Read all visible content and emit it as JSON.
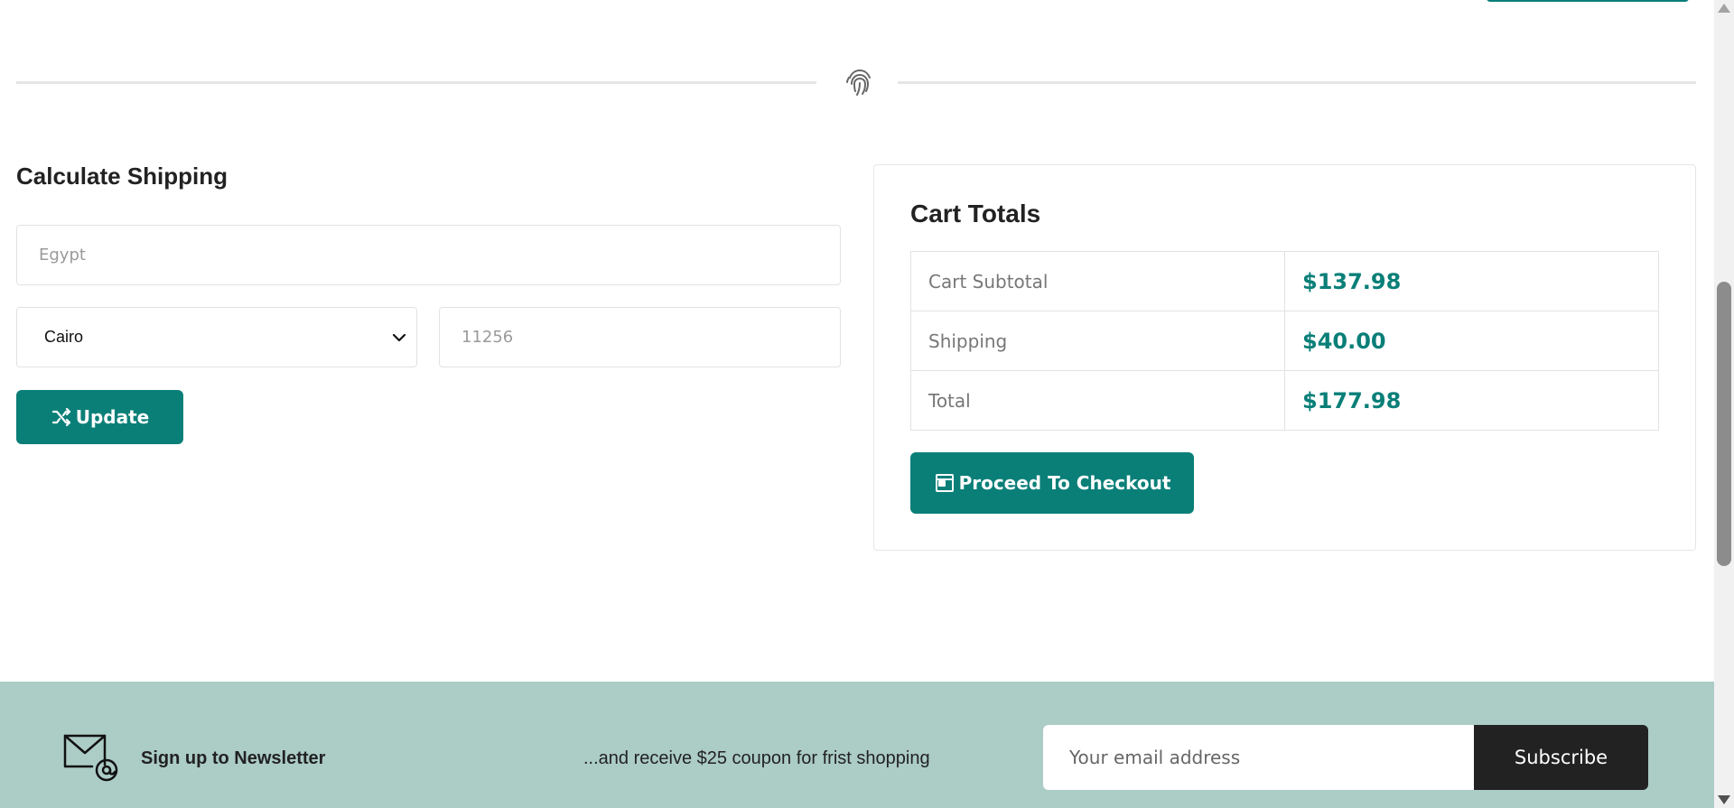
{
  "shipping": {
    "title": "Calculate Shipping",
    "country_placeholder": "Egypt",
    "city_value": "Cairo",
    "zip_placeholder": "11256",
    "update_label": "Update"
  },
  "totals": {
    "title": "Cart Totals",
    "rows": [
      {
        "label": "Cart Subtotal",
        "value": "$137.98"
      },
      {
        "label": "Shipping",
        "value": "$40.00"
      },
      {
        "label": "Total",
        "value": "$177.98"
      }
    ],
    "checkout_label": "Proceed To Checkout"
  },
  "newsletter": {
    "title": "Sign up to Newsletter",
    "description": "...and receive $25 coupon for frist shopping",
    "email_placeholder": "Your email address",
    "subscribe_label": "Subscribe"
  },
  "icons": {
    "divider": "fingerprint-icon",
    "update": "shuffle-icon",
    "checkout": "window-icon",
    "newsletter": "mail-at-icon"
  },
  "colors": {
    "accent": "#0a7f78",
    "newsletter_bg": "#acccc6",
    "subscribe_bg": "#222222"
  }
}
